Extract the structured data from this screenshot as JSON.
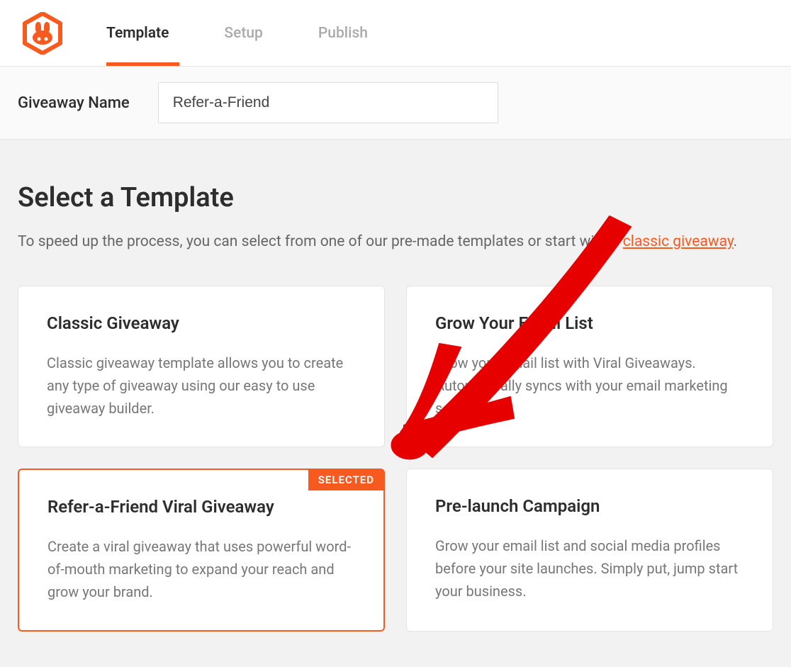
{
  "tabs": [
    {
      "label": "Template",
      "active": true
    },
    {
      "label": "Setup",
      "active": false
    },
    {
      "label": "Publish",
      "active": false
    }
  ],
  "nameRow": {
    "label": "Giveaway Name",
    "value": "Refer-a-Friend"
  },
  "section": {
    "heading": "Select a Template",
    "subtext_pre": "To speed up the process, you can select from one of our pre-made templates or start with a ",
    "subtext_link": "classic giveaway",
    "subtext_post": "."
  },
  "selectedBadge": "SELECTED",
  "templates": [
    {
      "title": "Classic Giveaway",
      "desc": "Classic giveaway template allows you to create any type of giveaway using our easy to use giveaway builder.",
      "selected": false
    },
    {
      "title": "Grow Your Email List",
      "desc": "Grow your email list with Viral Giveaways. Automatically syncs with your email marketing service.",
      "selected": false
    },
    {
      "title": "Refer-a-Friend Viral Giveaway",
      "desc": "Create a viral giveaway that uses powerful word-of-mouth marketing to expand your reach and grow your brand.",
      "selected": true
    },
    {
      "title": "Pre-launch Campaign",
      "desc": "Grow your email list and social media profiles before your site launches. Simply put, jump start your business.",
      "selected": false
    }
  ]
}
